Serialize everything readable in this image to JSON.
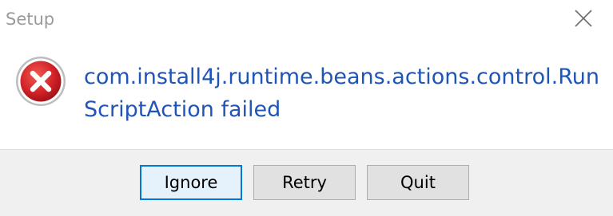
{
  "window": {
    "title": "Setup",
    "close_icon": "close-icon"
  },
  "message": {
    "icon": "error-icon",
    "text": "com.install4j.runtime.beans.actions.control.RunScriptAction failed"
  },
  "buttons": {
    "ignore_label": "Ignore",
    "retry_label": "Retry",
    "quit_label": "Quit"
  },
  "colors": {
    "message_text": "#1f55b7",
    "error_red": "#d1202a",
    "footer_bg": "#f0f0f0",
    "default_button_border": "#0078d7"
  }
}
